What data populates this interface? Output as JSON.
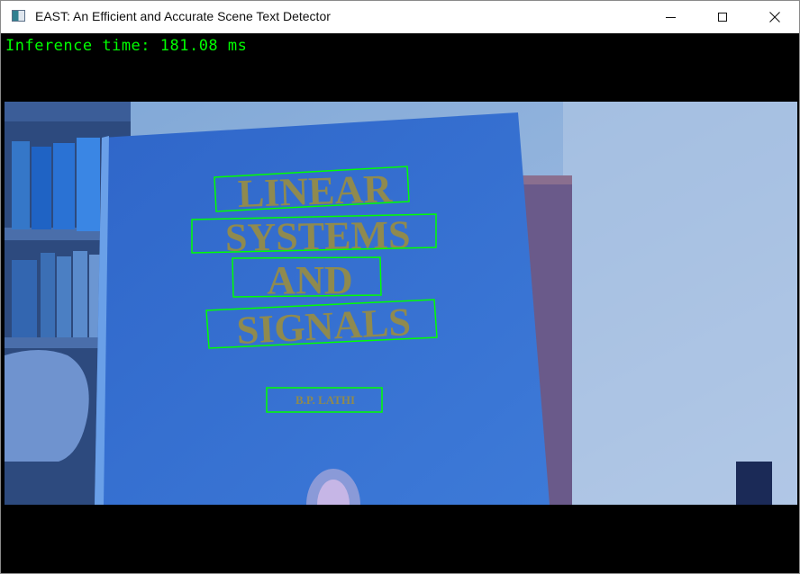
{
  "window": {
    "title": "EAST: An Efficient and Accurate Scene Text Detector",
    "controls": {
      "minimize": "minimize-icon",
      "maximize": "maximize-icon",
      "close": "close-icon"
    }
  },
  "overlay": {
    "inference_text": "Inference time: 181.08 ms",
    "color": "#00ff00"
  },
  "detections": [
    {
      "text": "LINEAR"
    },
    {
      "text": "SYSTEMS"
    },
    {
      "text": "AND"
    },
    {
      "text": "SIGNALS"
    },
    {
      "text": "B.P. LATHI"
    }
  ]
}
